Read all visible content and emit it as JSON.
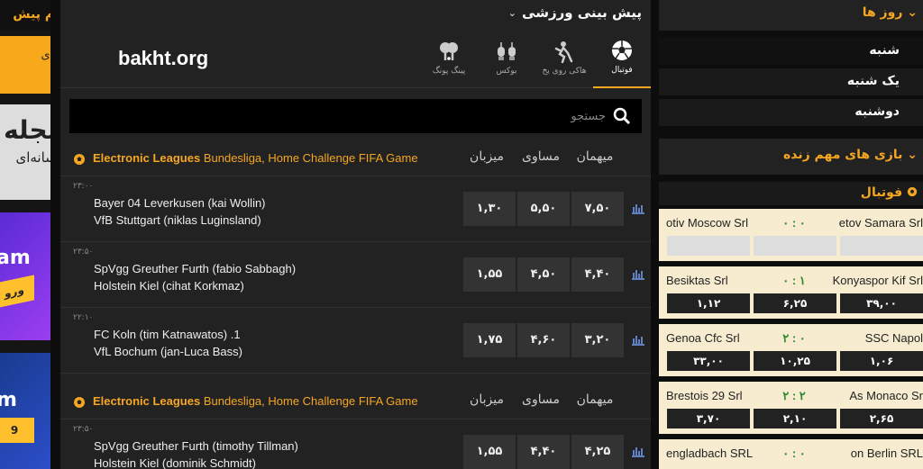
{
  "left_ads": {
    "form_title": "فرم پیش",
    "banner1": "برای",
    "banner2_title": "مجله",
    "banner2_sub": "رسانه‌ای",
    "banner3_title": "am",
    "banner3_btn": "ورو",
    "banner4_title": "m",
    "banner4_btn": "9"
  },
  "center": {
    "title": "پیش بینی ورزشی",
    "logo": "bakht.org",
    "tabs": [
      {
        "label": "فوتبال",
        "icon": "soccer-ball-icon"
      },
      {
        "label": "هاکی روی یخ",
        "icon": "hockey-player-icon"
      },
      {
        "label": "بوکس",
        "icon": "boxing-gloves-icon"
      },
      {
        "label": "پینگ پونگ",
        "icon": "ping-pong-icon"
      }
    ],
    "search_placeholder": "جستجو",
    "columns": {
      "away": "میهمان",
      "draw": "مساوی",
      "home": "میزبان"
    },
    "groups": [
      {
        "league_bold": "Electronic Leagues",
        "league_rest": " Bundesliga, Home Challenge FIFA Game",
        "matches": [
          {
            "time": "۲۳:۰۰",
            "team1": "Bayer 04 Leverkusen (kai Wollin)",
            "team2": "VfB Stuttgart (niklas Luginsland)",
            "odds": [
              "۷,۵۰",
              "۵,۵۰",
              "۱,۳۰"
            ]
          },
          {
            "time": "۲۳:۵۰",
            "team1": "SpVgg Greuther Furth (fabio Sabbagh)",
            "team2": "Holstein Kiel (cihat Korkmaz)",
            "odds": [
              "۴,۴۰",
              "۴,۵۰",
              "۱,۵۵"
            ]
          },
          {
            "time": "۲۲:۱۰",
            "team1": "FC Koln (tim Katnawatos) .1",
            "team2": "VfL Bochum (jan-Luca Bass)",
            "odds": [
              "۳,۲۰",
              "۴,۶۰",
              "۱,۷۵"
            ]
          }
        ]
      },
      {
        "league_bold": "Electronic Leagues",
        "league_rest": " Bundesliga, Home Challenge FIFA Game",
        "matches": [
          {
            "time": "۲۳:۵۰",
            "team1": "SpVgg Greuther Furth (timothy Tillman)",
            "team2": "Holstein Kiel (dominik Schmidt)",
            "odds": [
              "۴,۲۵",
              "۴,۴۰",
              "۱,۵۵"
            ]
          }
        ]
      }
    ]
  },
  "right": {
    "days_title": "روز ها",
    "days": [
      "شنبه",
      "یک شنبه",
      "دوشنبه"
    ],
    "live_title": "بازی های مهم زنده",
    "sport": "فوتبال",
    "live_matches": [
      {
        "home": "etov Samara Srl",
        "away": "otiv Moscow Srl",
        "score": "۰ : ۰",
        "odds": [
          "",
          "",
          ""
        ]
      },
      {
        "home": "Konyaspor Kif Srl",
        "away": "Besiktas Srl",
        "score": "۰ : ۱",
        "odds": [
          "۳۹,۰۰",
          "۶,۲۵",
          "۱,۱۲"
        ]
      },
      {
        "home": "SSC Napol",
        "away": "Genoa Cfc Srl",
        "score": "۲ : ۰",
        "odds": [
          "۱,۰۶",
          "۱۰,۲۵",
          "۳۳,۰۰"
        ]
      },
      {
        "home": "As Monaco Sr",
        "away": "Brestois 29 Srl",
        "score": "۲ : ۲",
        "odds": [
          "۲,۶۵",
          "۲,۱۰",
          "۳,۷۰"
        ]
      },
      {
        "home": "on Berlin SRL",
        "away": "engladbach SRL",
        "score": "۰ : ۰",
        "odds": [
          "",
          "",
          ""
        ]
      }
    ]
  }
}
